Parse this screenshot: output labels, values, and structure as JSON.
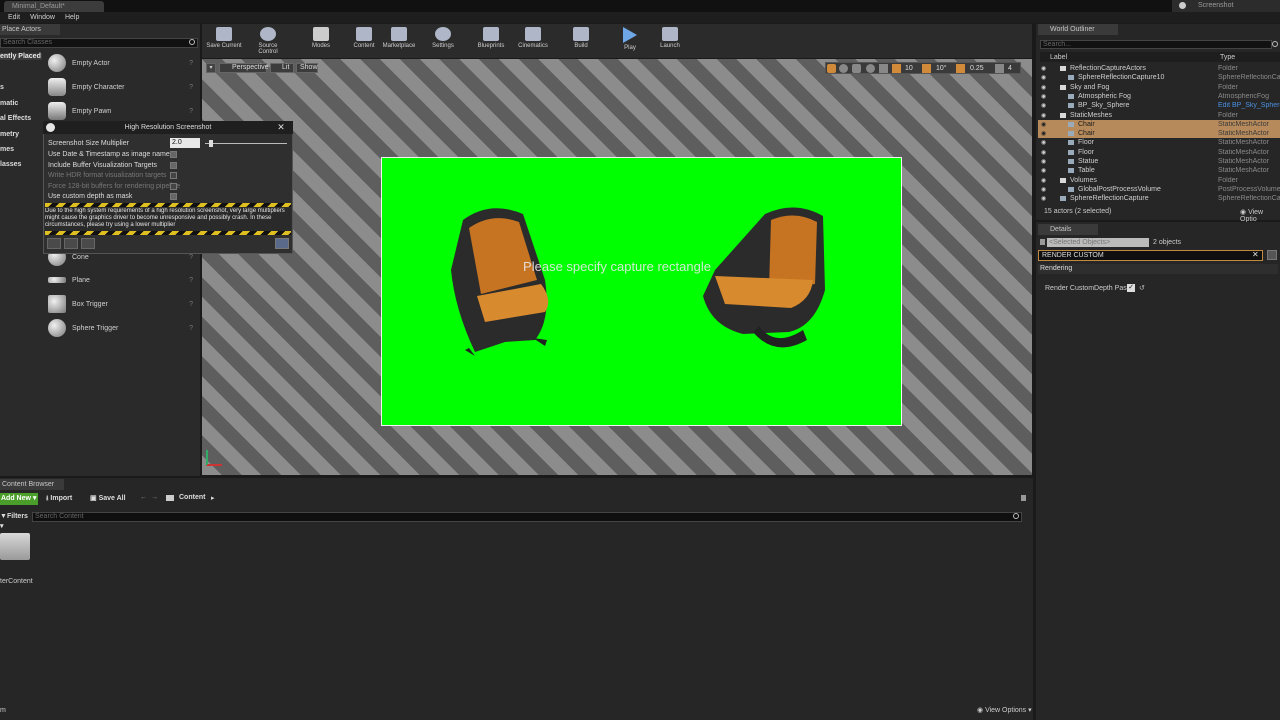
{
  "window": {
    "doc_tab": "Minimal_Default*",
    "right_tab": "Screenshot",
    "menu": [
      "Edit",
      "Window",
      "Help"
    ]
  },
  "place_actors": {
    "tab": "Place Actors",
    "search_placeholder": "Search Classes",
    "categories": [
      "ently Placed",
      "s",
      "matic",
      "",
      "al Effects",
      "metry",
      "mes",
      "lasses"
    ],
    "items_top": [
      "Empty Actor",
      "Empty Character",
      "Empty Pawn"
    ],
    "items_bottom": [
      "Cone",
      "Plane",
      "Box Trigger",
      "Sphere Trigger"
    ]
  },
  "toolbar": {
    "buttons": [
      "Save Current",
      "Source Control",
      "Modes",
      "Content",
      "Marketplace",
      "Settings",
      "Blueprints",
      "Cinematics",
      "Build",
      "Play",
      "Launch"
    ]
  },
  "viewport": {
    "perspective": "Perspective",
    "lit": "Lit",
    "show": "Show",
    "snap_values": [
      "10",
      "10°",
      "0.25",
      "4"
    ],
    "overlay_text": "Please specify capture rectangle"
  },
  "hires_dialog": {
    "title": "High Resolution Screenshot",
    "multiplier_label": "Screenshot Size Multiplier",
    "multiplier_value": "2.0",
    "multiplier_fraction": 0.05,
    "options": [
      {
        "label": "Use Date & Timestamp as image name",
        "enabled": true
      },
      {
        "label": "Include Buffer Visualization Targets",
        "enabled": true
      },
      {
        "label": "Write HDR format visualization targets",
        "enabled": false
      },
      {
        "label": "Force 128-bit buffers for rendering pipeline",
        "enabled": false
      },
      {
        "label": "Use custom depth as mask",
        "enabled": true
      }
    ],
    "warning": "Due to the high system requirements of a high resolution screenshot, very large multipliers might cause the graphics driver to become unresponsive and possibly crash. In these circumstances, please try using a lower multiplier"
  },
  "world_outliner": {
    "tab": "World Outliner",
    "search_placeholder": "Search...",
    "col_label": "Label",
    "col_type": "Type",
    "rows": [
      {
        "label": "ReflectionCaptureActors",
        "type": "Folder",
        "indent": 1,
        "kind": "folder"
      },
      {
        "label": "SphereReflectionCapture10",
        "type": "SphereReflectionCapt",
        "indent": 2,
        "kind": "actor"
      },
      {
        "label": "Sky and Fog",
        "type": "Folder",
        "indent": 1,
        "kind": "folder"
      },
      {
        "label": "Atmospheric Fog",
        "type": "AtmosphericFog",
        "indent": 2,
        "kind": "actor"
      },
      {
        "label": "BP_Sky_Sphere",
        "type": "Edit BP_Sky_Sphere",
        "indent": 2,
        "kind": "actor",
        "link": true
      },
      {
        "label": "StaticMeshes",
        "type": "Folder",
        "indent": 1,
        "kind": "folder"
      },
      {
        "label": "Chair",
        "type": "StaticMeshActor",
        "indent": 2,
        "kind": "actor",
        "selected": true
      },
      {
        "label": "Chair",
        "type": "StaticMeshActor",
        "indent": 2,
        "kind": "actor",
        "selected": true
      },
      {
        "label": "Floor",
        "type": "StaticMeshActor",
        "indent": 2,
        "kind": "actor"
      },
      {
        "label": "Floor",
        "type": "StaticMeshActor",
        "indent": 2,
        "kind": "actor"
      },
      {
        "label": "Statue",
        "type": "StaticMeshActor",
        "indent": 2,
        "kind": "actor"
      },
      {
        "label": "Table",
        "type": "StaticMeshActor",
        "indent": 2,
        "kind": "actor"
      },
      {
        "label": "Volumes",
        "type": "Folder",
        "indent": 1,
        "kind": "folder"
      },
      {
        "label": "GlobalPostProcessVolume",
        "type": "PostProcessVolume",
        "indent": 2,
        "kind": "actor"
      },
      {
        "label": "SphereReflectionCapture",
        "type": "SphereReflectionCapt",
        "indent": 1,
        "kind": "actor"
      }
    ],
    "status": "15 actors (2 selected)",
    "view_options": "View Optio"
  },
  "details": {
    "tab": "Details",
    "selected_placeholder": "<Selected Objects>",
    "count": "2 objects",
    "search_value": "RENDER CUSTOM",
    "section": "Rendering",
    "property": "Render CustomDepth Pass"
  },
  "content_browser": {
    "tab": "Content Browser",
    "add_new": "Add New",
    "import": "Import",
    "save_all": "Save All",
    "path": "Content",
    "filters": "Filters",
    "search_placeholder": "Search Content",
    "folder_label": "terContent",
    "items_count": "m",
    "view_options": "View Options"
  },
  "colors": {
    "accent_select": "#b68a5b",
    "green_screen": "#00ff00",
    "add_new_green": "#4a9e2a"
  }
}
